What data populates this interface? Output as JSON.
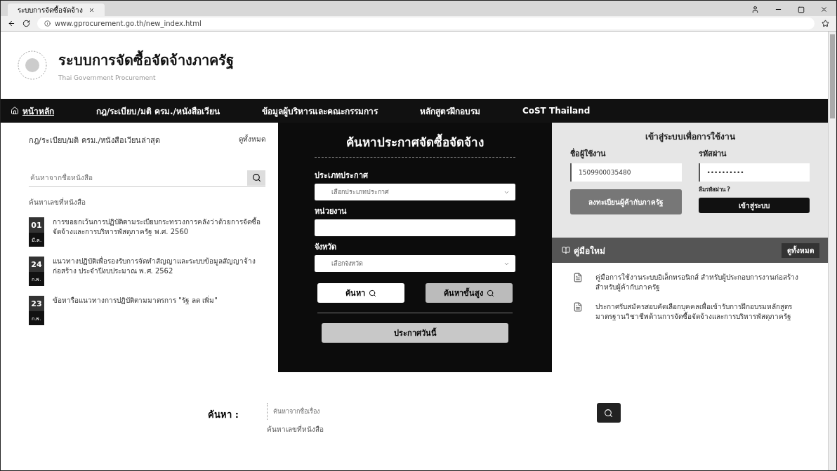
{
  "browser": {
    "tab_title": "ระบบการจัดซื้อจัดจ้าง",
    "url": "www.gprocurement.go.th/new_index.html"
  },
  "header": {
    "title": "ระบบการจัดซื้อจัดจ้างภาครัฐ",
    "subtitle": "Thai Government Procurement"
  },
  "nav": [
    {
      "label": "หน้าหลัก",
      "selected": true
    },
    {
      "label": "กฎ/ระเบียบ/มติ ครม./หนังสือเวียน",
      "selected": false
    },
    {
      "label": "ข้อมูลผู้บริหารและคณะกรรมการ",
      "selected": false
    },
    {
      "label": "หลักสูตรฝึกอบรม",
      "selected": false
    },
    {
      "label": "CoST Thailand",
      "selected": false
    }
  ],
  "laws": {
    "title": "กฎ/ระเบียบ/มติ ครม./หนังสือเวียนล่าสุด",
    "view_all": "ดูทั้งหมด",
    "search_placeholder": "ค้นหาจากชื่อหนังสือ",
    "search_note": "ค้นหาเลขที่หนังสือ",
    "items": [
      {
        "day": "01",
        "month": "มี.ค.",
        "text": "การขอยกเว้นการปฏิบัติตามระเบียบกระทรวงการคลังว่าด้วยการจัดซื้อจัดจ้างและการบริหารพัสดุภาครัฐ พ.ศ. 2560"
      },
      {
        "day": "24",
        "month": "ก.พ.",
        "text": "แนวทางปฏิบัติเพื่อรองรับการจัดทำสัญญาและระบบข้อมูลสัญญาจ้างก่อสร้าง ประจำปีงบประมาณ พ.ศ. 2562"
      },
      {
        "day": "23",
        "month": "ก.พ.",
        "text": "ข้อหารือแนวทางการปฏิบัติตามมาตรการ \"รัฐ ลด เพิ่ม\""
      }
    ]
  },
  "announce_search": {
    "title": "ค้นหาประกาศจัดซื้อจัดจ้าง",
    "fields": [
      {
        "kind": "select",
        "label": "ประเภทประกาศ",
        "value": "เลือกประเภทประกาศ"
      },
      {
        "kind": "text",
        "label": "หน่วยงาน"
      },
      {
        "kind": "select",
        "label": "จังหวัด",
        "value": "เลือกจังหวัด"
      }
    ],
    "search_button": "ค้นหา",
    "advanced_button": "ค้นหาขั้นสูง",
    "today_button": "ประกาศวันนี้"
  },
  "login": {
    "title": "เข้าสู่ระบบเพื่อการใช้งาน",
    "username_label": "ชื่อผู้ใช้งาน",
    "username_value": "1509900035480",
    "password_label": "รหัสผ่าน",
    "password_value": "••••••••••",
    "forgot": "ลืมรหัสผ่าน ?",
    "register_button": "ลงทะเบียนผู้ค้ากับภาครัฐ",
    "login_button": "เข้าสู่ระบบ"
  },
  "manuals": {
    "title": "คู่มือใหม่",
    "view_all": "ดูทั้งหมด",
    "items": [
      {
        "text": "คู่มือการใช้งานระบบอิเล็กทรอนิกส์ สำหรับผู้ประกอบการงานก่อสร้าง สำหรับผู้ค้ากับภาครัฐ"
      },
      {
        "text": "ประกาศรับสมัครสอบคัดเลือกบุคคลเพื่อเข้ารับการฝึกอบรมหลักสูตรมาตรฐานวิชาชีพด้านการจัดซื้อจัดจ้างและการบริหารพัสดุภาครัฐ"
      }
    ]
  },
  "bottom_search": {
    "label": "ค้นหา :",
    "placeholder": "ค้นหาจากชื่อเรื่อง",
    "note": "ค้นหาเลขที่หนังสือ"
  }
}
